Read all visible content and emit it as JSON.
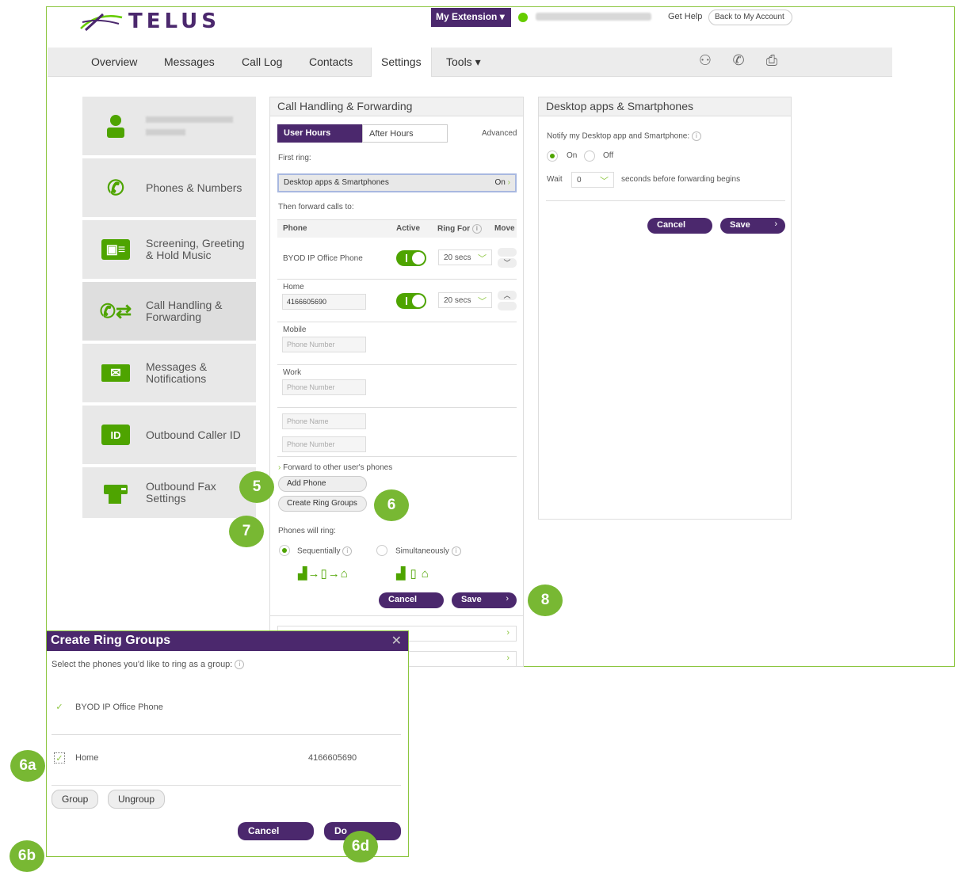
{
  "header": {
    "brand": "TELUS",
    "extension_btn": "My Extension",
    "get_help": "Get Help",
    "back_to_account": "Back to My Account"
  },
  "nav": {
    "items": [
      "Overview",
      "Messages",
      "Call Log",
      "Contacts",
      "Settings",
      "Tools"
    ],
    "active": "Settings"
  },
  "sidebar": {
    "items": [
      {
        "label": "",
        "icon": "user-icon"
      },
      {
        "label": "Phones & Numbers",
        "icon": "phone-keypad-icon"
      },
      {
        "label": "Screening, Greeting & Hold Music",
        "icon": "contact-card-icon"
      },
      {
        "label": "Call Handling & Forwarding",
        "icon": "call-forward-icon"
      },
      {
        "label": "Messages & Notifications",
        "icon": "envelope-icon"
      },
      {
        "label": "Outbound Caller ID",
        "icon": "id-badge-icon"
      },
      {
        "label": "Outbound Fax Settings",
        "icon": "fax-icon"
      }
    ],
    "id_badge_text": "ID"
  },
  "call_handling": {
    "title": "Call Handling & Forwarding",
    "tabs": [
      "User Hours",
      "After Hours"
    ],
    "advanced": "Advanced",
    "first_ring_label": "First ring:",
    "first_ring_value": "Desktop apps & Smartphones",
    "first_ring_state": "On",
    "then_forward": "Then forward calls to:",
    "columns": [
      "Phone",
      "Active",
      "Ring For",
      "Move"
    ],
    "byod_phone": "BYOD IP Office Phone",
    "byod_ring": "20 secs",
    "home_label": "Home",
    "home_number": "4166605690",
    "home_ring": "20 secs",
    "mobile_label": "Mobile",
    "work_label": "Work",
    "phone_number_placeholder": "Phone Number",
    "phone_name_placeholder": "Phone Name",
    "forward_other": "Forward to other user's phones",
    "add_phone": "Add Phone",
    "create_ring_groups": "Create Ring Groups",
    "phones_will_ring": "Phones will ring:",
    "sequentially": "Sequentially",
    "simultaneously": "Simultaneously",
    "cancel": "Cancel",
    "save": "Save"
  },
  "desktop_apps": {
    "title": "Desktop apps & Smartphones",
    "notify_label": "Notify my Desktop app and Smartphone:",
    "on": "On",
    "off": "Off",
    "wait": "Wait",
    "wait_value": "0",
    "seconds_text": "seconds before forwarding begins",
    "cancel": "Cancel",
    "save": "Save"
  },
  "dialog": {
    "title": "Create Ring Groups",
    "instruction": "Select the phones you'd like to ring as a group:",
    "phones": [
      {
        "name": "BYOD IP Office Phone",
        "number": ""
      },
      {
        "name": "Home",
        "number": "4166605690"
      }
    ],
    "group": "Group",
    "ungroup": "Ungroup",
    "cancel": "Cancel",
    "done": "Do"
  },
  "callouts": [
    "5",
    "6",
    "7",
    "8",
    "6a",
    "6b",
    "6d"
  ],
  "colors": {
    "purple": "#4b286d",
    "green": "#4ea400",
    "callout": "#78b833"
  }
}
